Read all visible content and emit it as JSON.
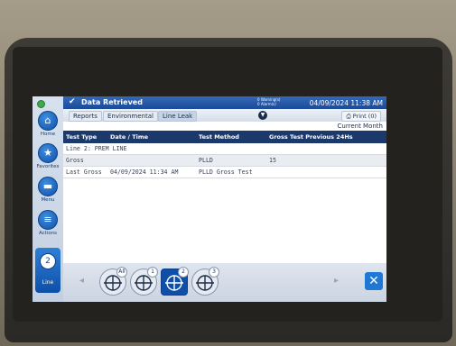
{
  "header": {
    "status_title": "Data Retrieved",
    "warnings": "0 Warning(s)",
    "alarms": "0 Alarm(s)",
    "datetime": "04/09/2024 11:38 AM"
  },
  "nav": {
    "home": "Home",
    "favorites": "Favorites",
    "menu": "Menu",
    "actions": "Actions",
    "line_number": "2",
    "line": "Line"
  },
  "breadcrumb": [
    "Reports",
    "Environmental",
    "Line Leak"
  ],
  "toolbar": {
    "print_label": "Print (0)"
  },
  "range_label": "Current Month",
  "table": {
    "headers": [
      "Test Type",
      "Date / Time",
      "Test Method",
      "Gross Test Previous 24Hs"
    ],
    "group_row": "Line 2: PREM LINE",
    "rows": [
      [
        "Gross",
        "",
        "PLLD",
        "15"
      ],
      [
        "Last Gross",
        "04/09/2024 11:34 AM",
        "PLLD Gross Test",
        ""
      ]
    ]
  },
  "line_selector": {
    "items": [
      {
        "tag": "All",
        "selected": false
      },
      {
        "tag": "1",
        "selected": false
      },
      {
        "tag": "2",
        "selected": true
      },
      {
        "tag": "3",
        "selected": false
      }
    ]
  },
  "icons": {
    "status": "check-icon",
    "home": "home-icon",
    "favorites": "star-icon",
    "menu": "menu-icon",
    "actions": "actions-icon",
    "print": "printer-icon",
    "close": "close-icon"
  },
  "colors": {
    "header": "#1a4a98",
    "table_header": "#1b3a6b",
    "accent": "#1e78d4",
    "status_ok": "#3fa84a"
  }
}
